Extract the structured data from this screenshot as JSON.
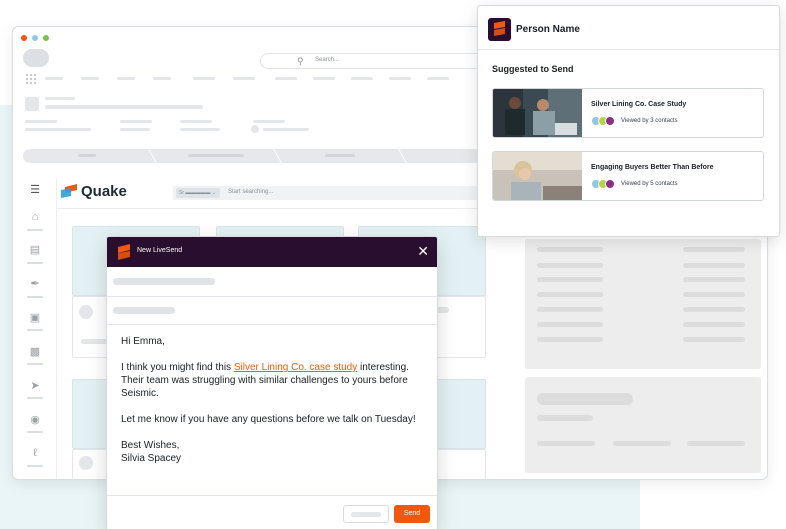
{
  "browser": {
    "search_placeholder": "Search...",
    "traffic_lights": [
      "#f2580c",
      "#8fc8e2",
      "#7ac14a"
    ]
  },
  "app": {
    "logo_text": "Quake",
    "search_filter": "Sr ▬▬▬▬▬ ⌄",
    "search_placeholder": "Start searching..."
  },
  "popup": {
    "title": "Person Name",
    "section_title": "Suggested to Send",
    "items": [
      {
        "name": "Silver Lining Co. Case Study",
        "views": "Viewed by 3 contacts"
      },
      {
        "name": "Engaging Buyers Better Than Before",
        "views": "Viewed by 5 contacts"
      }
    ]
  },
  "compose": {
    "title": "New LiveSend",
    "greeting": "Hi Emma,",
    "para1_before": "I think you might find this ",
    "para1_link": "Silver Lining Co. case study",
    "para1_after": " interesting. Their team was struggling with similar challenges to yours before Seismic.",
    "para2": "Let me know if you have any questions before we talk on Tuesday!",
    "signoff": "Best Wishes,",
    "signature": "Silvia Spacey",
    "send_label": "Send"
  },
  "colors": {
    "brand_dark": "#2a0e2f",
    "brand_orange": "#f2580c",
    "avatar_colors": [
      "#8fc8e2",
      "#b8d24a",
      "#8b2f86"
    ]
  }
}
